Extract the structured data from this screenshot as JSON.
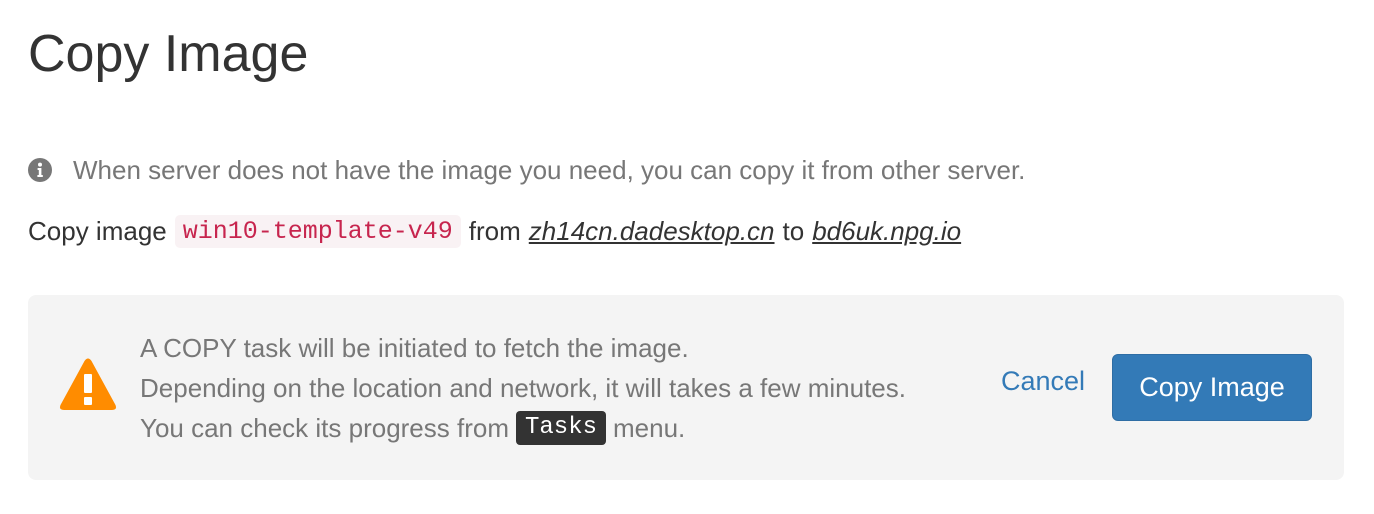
{
  "page": {
    "title": "Copy Image"
  },
  "info": {
    "icon": "info-circle-icon",
    "text": "When server does not have the image you need, you can copy it from other server."
  },
  "copy_line": {
    "prefix": "Copy image",
    "image_name": "win10-template-v49",
    "from_label": "from",
    "source_server": "zh14cn.dadesktop.cn",
    "to_label": "to",
    "target_server": "bd6uk.npg.io"
  },
  "confirm": {
    "icon": "warning-triangle-icon",
    "line1": "A COPY task will be initiated to fetch the image.",
    "line2": "Depending on the location and network, it will takes a few minutes.",
    "line3_prefix": "You can check its progress from",
    "line3_menu": "Tasks",
    "line3_suffix": "menu.",
    "cancel_label": "Cancel",
    "submit_label": "Copy Image"
  },
  "colors": {
    "primary": "#337ab7",
    "warning": "#ff8c00",
    "code": "#c7254e",
    "panel_bg": "#f4f4f4",
    "muted_text": "#777777"
  }
}
